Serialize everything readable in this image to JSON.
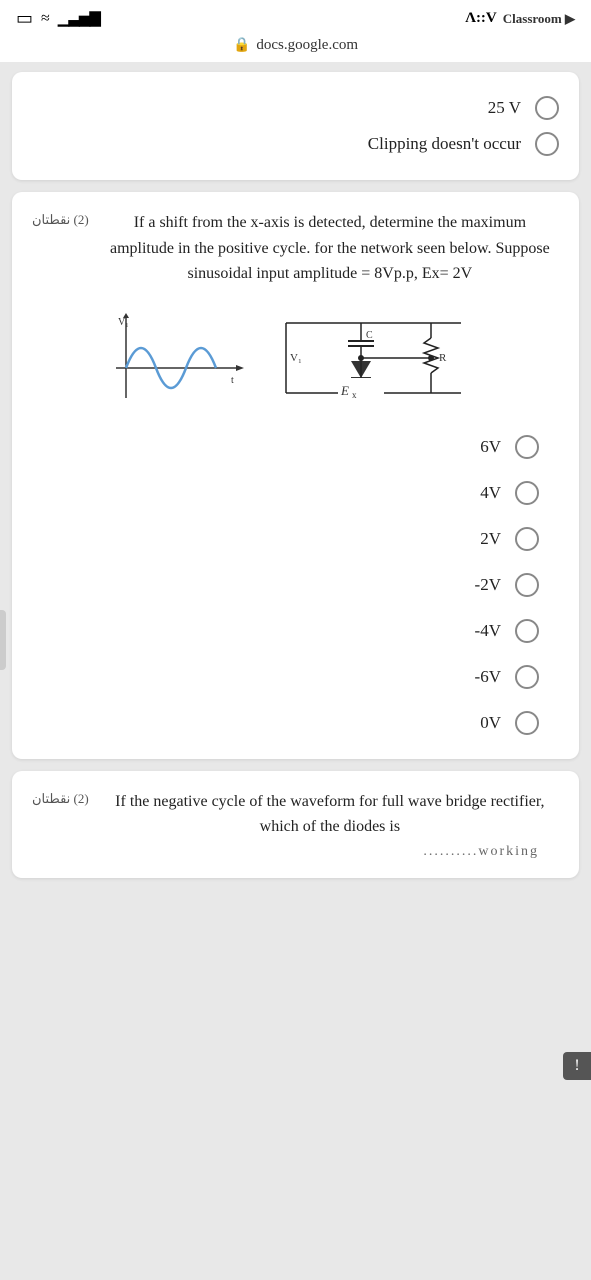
{
  "statusBar": {
    "signal": "●●●",
    "wifi": "wifi",
    "appTitle": "Λ::V",
    "classroom": "Classroom ▶"
  },
  "addressBar": {
    "url": "docs.google.com",
    "lockIcon": "🔒"
  },
  "card1": {
    "answer1": "25 V",
    "answer2": "Clipping doesn't occur"
  },
  "card2": {
    "points": "(2) نقطتان",
    "questionText": "If a shift from the x-axis is detected, determine the maximum amplitude in the positive cycle. for the network seen below. Suppose sinusoidal input amplitude = 8Vp.p, Ex= 2V",
    "options": [
      "6V",
      "4V",
      "2V",
      "-2V",
      "-4V",
      "-6V",
      "0V"
    ]
  },
  "card3": {
    "points": "(2) نقطتان",
    "questionText": "If the negative cycle of the waveform for full wave bridge rectifier, which of the diodes is",
    "ellipsis": "..........working"
  }
}
